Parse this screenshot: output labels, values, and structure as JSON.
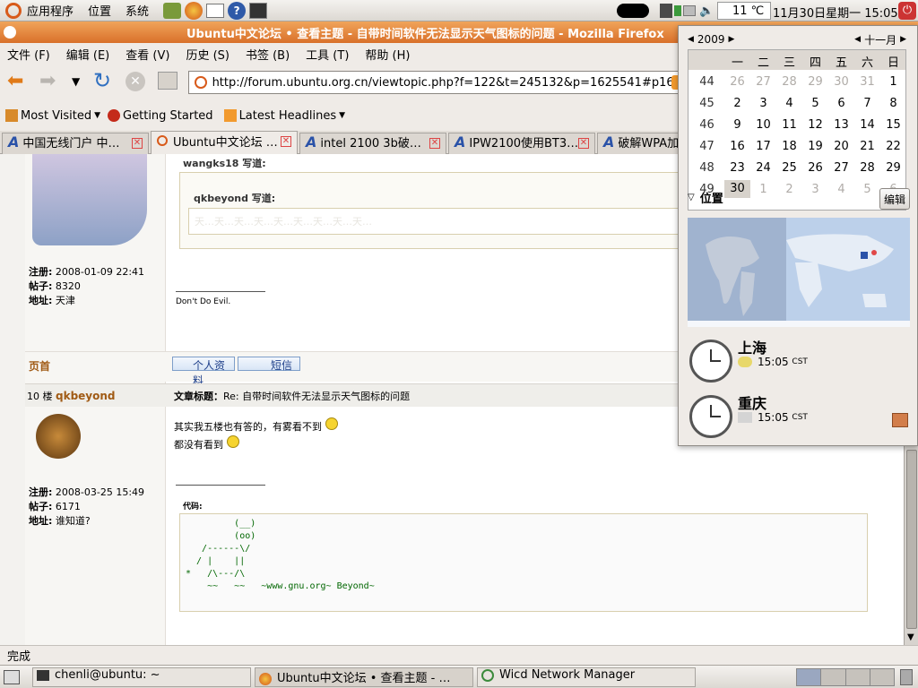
{
  "top_panel": {
    "menus": [
      "应用程序",
      "位置",
      "系统"
    ],
    "temperature": "11 ℃",
    "datetime": "11月30日星期一 15:05"
  },
  "window": {
    "title": "Ubuntu中文论坛 • 查看主题 - 自带时间软件无法显示天气图标的问题 - Mozilla Firefox"
  },
  "menubar": [
    "文件 (F)",
    "编辑 (E)",
    "查看 (V)",
    "历史 (S)",
    "书签 (B)",
    "工具 (T)",
    "帮助 (H)"
  ],
  "urlbar": {
    "url": "http://forum.ubuntu.org.cn/viewtopic.php?f=122&t=245132&p=1625541#p1625541"
  },
  "bookmarks": [
    "Most Visited",
    "Getting Started",
    "Latest Headlines"
  ],
  "tabs": [
    {
      "label": "中国无线门户 中…"
    },
    {
      "label": "Ubuntu中文论坛 …"
    },
    {
      "label": "intel 2100 3b破…"
    },
    {
      "label": "IPW2100使用BT3…"
    },
    {
      "label": "破解WPA加…"
    }
  ],
  "post1": {
    "quote_author": "wangks18 写道:",
    "inner_quote_author": "qkbeyond 写道:",
    "inner_quote_text": "天…天…天…天…天…天…天…天…天…",
    "registered_label": "注册:",
    "registered": "2008-01-09 22:41",
    "posts_label": "帖子:",
    "posts": "8320",
    "location_label": "地址:",
    "location": "天津",
    "signature": "Don't Do Evil.",
    "top_link": "页首",
    "profile_btn": "个人资料",
    "pm_btn": "短信"
  },
  "post2": {
    "floor": "10 楼",
    "author": "qkbeyond",
    "subject_label": "文章标题：",
    "subject": "Re: 自带时间软件无法显示天气图标的问题",
    "line1": "其实我五楼也有答的，有雾看不到",
    "line2": "都没有看到",
    "registered_label": "注册:",
    "registered": "2008-03-25 15:49",
    "posts_label": "帖子:",
    "posts": "6171",
    "location_label": "地址:",
    "location": "谁知道?",
    "code_label": "代码:",
    "code": "         (__)\n         (oo)\n   /------\\/\n  / |    ||\n*   /\\---/\\\n    ~~   ~~   ~www.gnu.org~ Beyond~"
  },
  "statusbar": {
    "text": "完成"
  },
  "taskbar": {
    "tasks": [
      "chenli@ubuntu: ~",
      "Ubuntu中文论坛 • 查看主题 - …",
      "Wicd Network Manager"
    ]
  },
  "calendar": {
    "year": "2009",
    "month": "十一月",
    "weekdays": [
      "一",
      "二",
      "三",
      "四",
      "五",
      "六",
      "日"
    ],
    "weeks": [
      {
        "num": "44",
        "days": [
          "26",
          "27",
          "28",
          "29",
          "30",
          "31",
          "1"
        ]
      },
      {
        "num": "45",
        "days": [
          "2",
          "3",
          "4",
          "5",
          "6",
          "7",
          "8"
        ]
      },
      {
        "num": "46",
        "days": [
          "9",
          "10",
          "11",
          "12",
          "13",
          "14",
          "15"
        ]
      },
      {
        "num": "47",
        "days": [
          "16",
          "17",
          "18",
          "19",
          "20",
          "21",
          "22"
        ]
      },
      {
        "num": "48",
        "days": [
          "23",
          "24",
          "25",
          "26",
          "27",
          "28",
          "29"
        ]
      },
      {
        "num": "49",
        "days": [
          "30",
          "1",
          "2",
          "3",
          "4",
          "5",
          "6"
        ]
      }
    ],
    "selected": "30"
  },
  "locations": {
    "header": "位置",
    "edit_btn": "编辑",
    "items": [
      {
        "city": "上海",
        "time": "15:05",
        "tz": "CST"
      },
      {
        "city": "重庆",
        "time": "15:05",
        "tz": "CST"
      }
    ]
  }
}
